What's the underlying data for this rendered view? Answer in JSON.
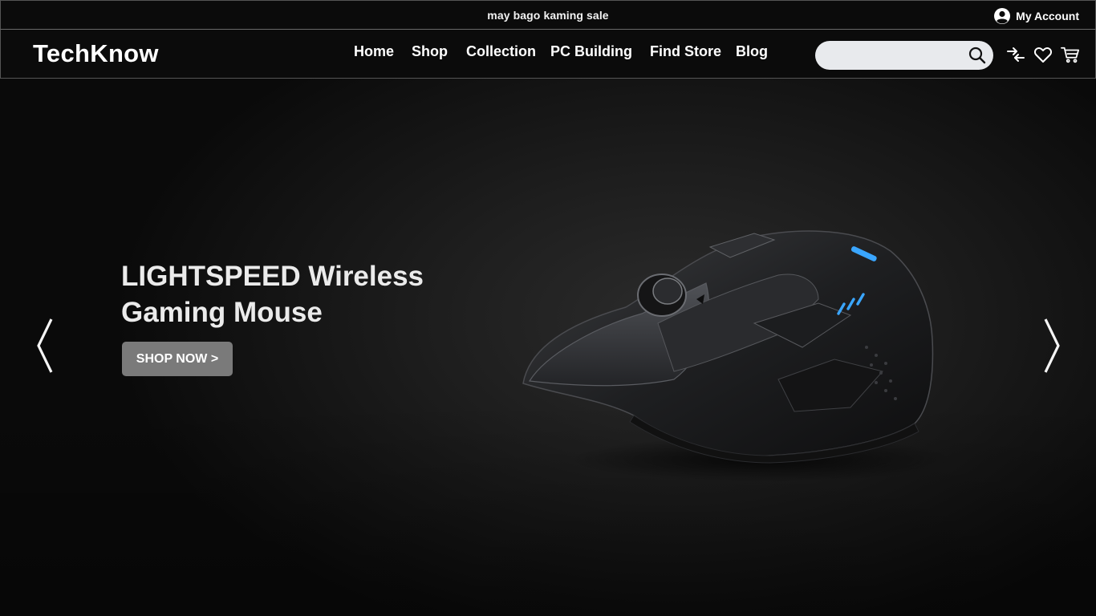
{
  "topbar": {
    "promo_text": "may bago kaming sale",
    "account_label": "My Account",
    "account_icon": "user-circle-icon"
  },
  "header": {
    "logo": "TechKnow",
    "nav": [
      {
        "label": "Home"
      },
      {
        "label": "Shop"
      },
      {
        "label": "Collection"
      },
      {
        "label": "PC Building"
      },
      {
        "label": "Find Store"
      },
      {
        "label": "Blog"
      }
    ],
    "search": {
      "placeholder": "",
      "value": "",
      "icon": "search-icon"
    },
    "icons": [
      "compare-arrows-icon",
      "heart-icon",
      "cart-icon"
    ]
  },
  "hero": {
    "title_line1": "LIGHTSPEED Wireless",
    "title_line2": "Gaming Mouse",
    "cta_label": "SHOP NOW >",
    "prev_icon": "chevron-left-icon",
    "next_icon": "chevron-right-icon",
    "product_image": "gaming-mouse-image"
  },
  "colors": {
    "background": "#0b0b0b",
    "hero_bg": "#1d1d1d",
    "search_bg": "#e8eaed",
    "cta_bg": "#7a7a7a",
    "accent_led": "#3aa6ff"
  }
}
